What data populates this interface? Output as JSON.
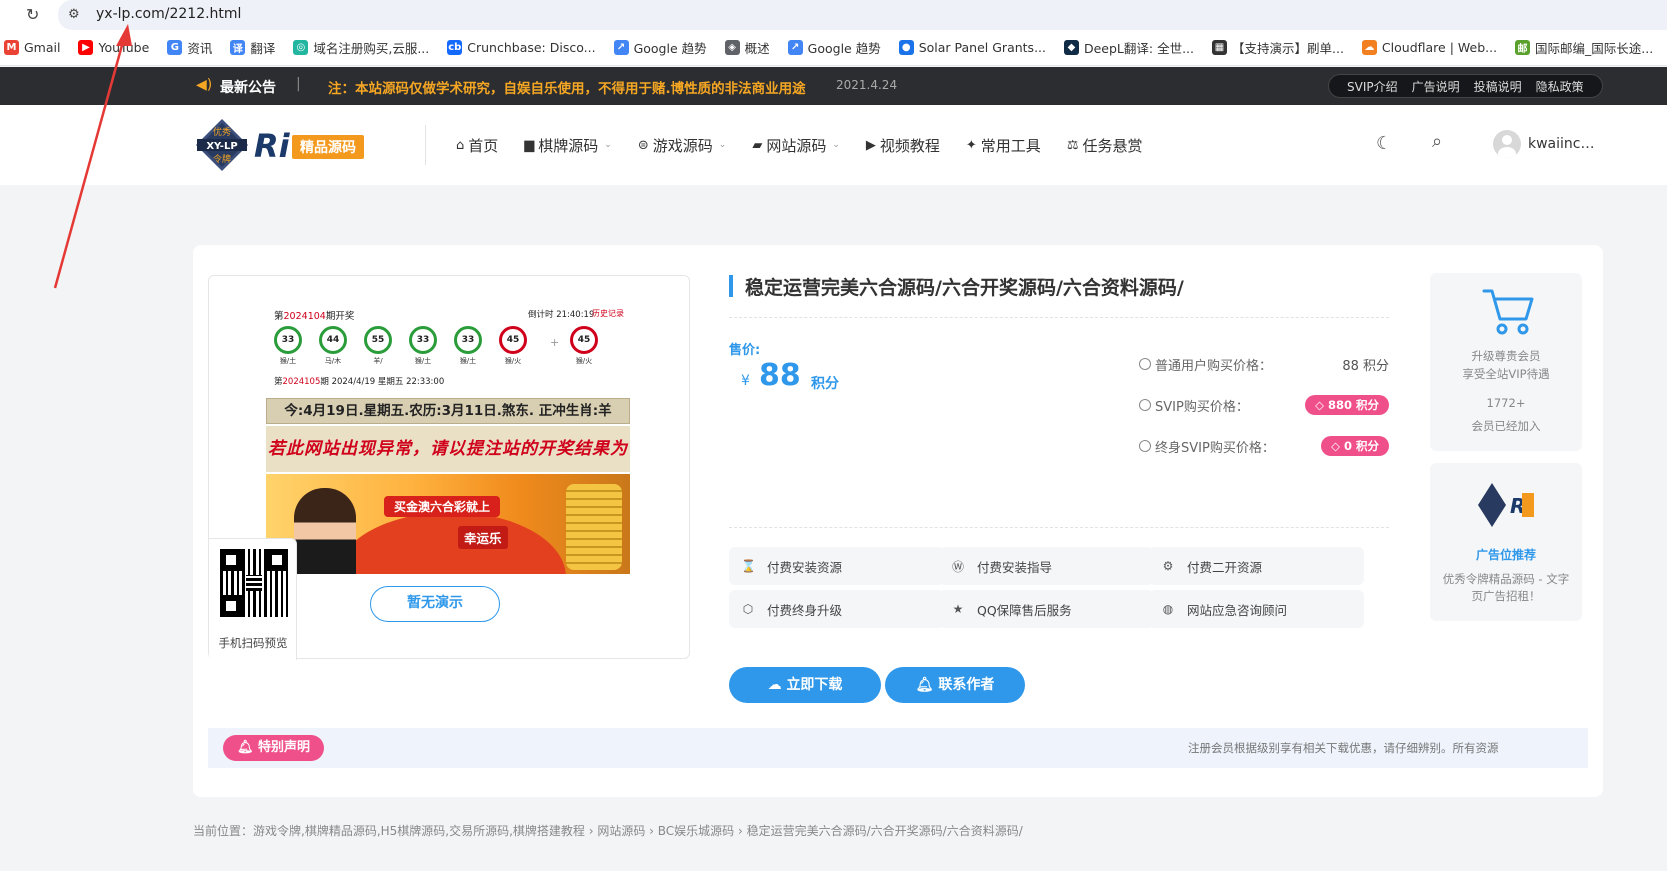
{
  "browser": {
    "url": "yx-lp.com/2212.html",
    "bookmarks": [
      {
        "label": "Gmail",
        "icon": "gmail-icon",
        "fav": "M",
        "color": "#ea4335"
      },
      {
        "label": "YouTube",
        "icon": "youtube-icon",
        "fav": "▶",
        "color": "#ff0000"
      },
      {
        "label": "资讯",
        "icon": "news-icon",
        "fav": "G",
        "color": "#4285f4"
      },
      {
        "label": "翻译",
        "icon": "translate-icon",
        "fav": "译",
        "color": "#4285f4"
      },
      {
        "label": "域名注册购买,云服...",
        "icon": "domain-icon",
        "fav": "◎",
        "color": "#22b5a0"
      },
      {
        "label": "Crunchbase: Disco...",
        "icon": "crunchbase-icon",
        "fav": "cb",
        "color": "#146aff"
      },
      {
        "label": "Google 趋势",
        "icon": "trends-icon",
        "fav": "↗",
        "color": "#4285f4"
      },
      {
        "label": "概述",
        "icon": "overview-icon",
        "fav": "◈",
        "color": "#5f6368"
      },
      {
        "label": "Google 趋势",
        "icon": "trends-icon",
        "fav": "↗",
        "color": "#4285f4"
      },
      {
        "label": "Solar Panel Grants...",
        "icon": "solar-icon",
        "fav": "●",
        "color": "#1a73e8"
      },
      {
        "label": "DeepL翻译: 全世...",
        "icon": "deepl-icon",
        "fav": "◆",
        "color": "#0f2b46"
      },
      {
        "label": "【支持演示】刷单...",
        "icon": "demo-icon",
        "fav": "▦",
        "color": "#333333"
      },
      {
        "label": "Cloudflare | Web...",
        "icon": "cloudflare-icon",
        "fav": "☁",
        "color": "#f38020"
      },
      {
        "label": "国际邮编_国际长途...",
        "icon": "postal-icon",
        "fav": "邮",
        "color": "#5aa02c"
      }
    ]
  },
  "notice": {
    "label": "最新公告",
    "message": "注：本站源码仅做学术研究，自娱自乐使用，不得用于赌.博性质的非法商业用途",
    "date": "2021.4.24",
    "links": [
      "SVIP介绍",
      "广告说明",
      "投稿说明",
      "隐私政策"
    ]
  },
  "header": {
    "logo": {
      "badge_top": "优秀",
      "badge_mid": "XY-LP",
      "badge_bottom": "令牌",
      "ri": "Ri",
      "tag": "精品源码"
    },
    "nav": [
      {
        "label": "首页",
        "icon": "home-icon",
        "glyph": "⌂",
        "dropdown": false
      },
      {
        "label": "棋牌源码",
        "icon": "folder-icon",
        "glyph": "▆",
        "dropdown": true
      },
      {
        "label": "游戏源码",
        "icon": "gamepad-icon",
        "glyph": "⊜",
        "dropdown": true
      },
      {
        "label": "网站源码",
        "icon": "folder-open-icon",
        "glyph": "▰",
        "dropdown": true
      },
      {
        "label": "视频教程",
        "icon": "play-icon",
        "glyph": "▶",
        "dropdown": false
      },
      {
        "label": "常用工具",
        "icon": "tools-icon",
        "glyph": "✦",
        "dropdown": false
      },
      {
        "label": "任务悬赏",
        "icon": "balance-icon",
        "glyph": "⚖",
        "dropdown": false
      }
    ],
    "username": "kwaiinc…"
  },
  "product": {
    "title": "稳定运营完美六合源码/六合开奖源码/六合资料源码/",
    "price_label": "售价:",
    "currency": "¥",
    "price": "88",
    "unit": "积分",
    "price_rows": [
      {
        "label": "普通用户购买价格：",
        "value": "88 积分",
        "pill": false
      },
      {
        "label": "SVIP购买价格：",
        "value": "880 积分",
        "pill": true
      },
      {
        "label": "终身SVIP购买价格：",
        "value": "0 积分",
        "pill": true
      }
    ],
    "features": [
      {
        "label": "付费安装资源",
        "icon": "hourglass-icon",
        "glyph": "⌛"
      },
      {
        "label": "付费安装指导",
        "icon": "wordpress-icon",
        "glyph": "Ⓦ"
      },
      {
        "label": "付费二开资源",
        "icon": "gear-icon",
        "glyph": "⚙"
      },
      {
        "label": "付费终身升级",
        "icon": "shield-icon",
        "glyph": "⬡"
      },
      {
        "label": "QQ保障售后服务",
        "icon": "star-icon",
        "glyph": "★"
      },
      {
        "label": "网站应急咨询顾问",
        "icon": "globe-icon",
        "glyph": "◍"
      }
    ],
    "download_label": "立即下载",
    "contact_label": "联系作者",
    "demo_label": "暂无演示",
    "qr_caption": "手机扫码预览"
  },
  "preview": {
    "draw_prefix": "第",
    "draw_no": "2024104",
    "draw_suffix": "期开奖",
    "countdown": "倒计时 21:40:19",
    "history": "历史记录",
    "balls": [
      {
        "num": "33",
        "sub": "猴/土",
        "color": "green"
      },
      {
        "num": "44",
        "sub": "马/木",
        "color": "green"
      },
      {
        "num": "55",
        "sub": "羊/",
        "color": "green"
      },
      {
        "num": "33",
        "sub": "猴/土",
        "color": "green"
      },
      {
        "num": "33",
        "sub": "猴/土",
        "color": "green"
      },
      {
        "num": "45",
        "sub": "猴/火",
        "color": "red"
      },
      {
        "num": "45",
        "sub": "猴/火",
        "color": "red"
      }
    ],
    "plus": "+",
    "next_prefix": "第",
    "next_no": "2024105",
    "next_suffix": "期 2024/4/19 星期五 22:33:00",
    "band1": "今:4月19日.星期五.农历:3月11日.煞东. 正冲生肖:羊",
    "band2": "若此网站出现异常，请以提注站的开奖结果为准！",
    "banner_t1": "买金澳六合彩就上",
    "banner_t2": "幸运乐"
  },
  "widgets": {
    "vip_line1": "升级尊贵会员",
    "vip_line2": "享受全站VIP待遇",
    "vip_count": "1772+",
    "vip_joined": "会员已经加入",
    "ad_title": "广告位推荐",
    "ad_desc": "优秀令牌精品源码 - 文字页广告招租！"
  },
  "declaration": {
    "label": "特别声明",
    "text": "注册会员根据级别享有相关下载优惠，请仔细辨别。所有资源"
  },
  "breadcrumb": "当前位置：游戏令牌,棋牌精品源码,H5棋牌源码,交易所源码,棋牌搭建教程 › 网站源码 › BC娱乐城源码 › 稳定运营完美六合源码/六合开奖源码/六合资料源码/",
  "colors": {
    "accent": "#2f98ea",
    "pink": "#f0508a",
    "notice_text": "#f5a623",
    "dark_bar": "#2b2d31"
  }
}
